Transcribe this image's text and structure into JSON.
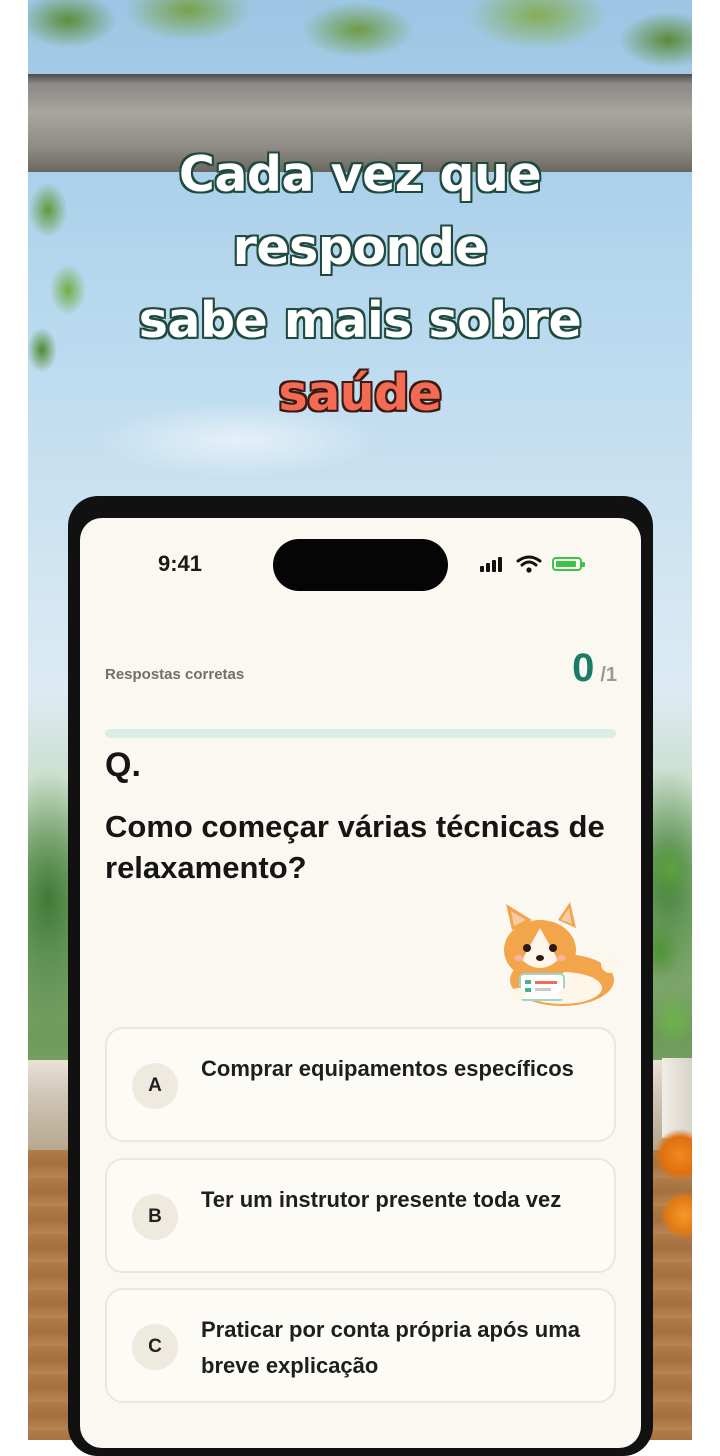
{
  "headline": {
    "line1": "Cada vez que",
    "line2": "responde",
    "line3": "sabe mais sobre",
    "highlight": "saúde"
  },
  "status_bar": {
    "time": "9:41",
    "icons": [
      "signal-icon",
      "wifi-icon",
      "battery-charging-icon"
    ]
  },
  "quiz": {
    "score_label": "Respostas corretas",
    "score_value": "0",
    "score_total": "/1",
    "progress_fraction": 0,
    "question_marker": "Q.",
    "question": "Como começar várias técnicas de relaxamento?",
    "mascot": "corgi-mascot-icon",
    "options": [
      {
        "letter": "A",
        "text": "Comprar equipamentos específicos"
      },
      {
        "letter": "B",
        "text": "Ter um instrutor presente toda vez"
      },
      {
        "letter": "C",
        "text": "Praticar por conta própria após uma breve explicação"
      }
    ]
  },
  "colors": {
    "accent": "#1c7a68",
    "highlight": "#f26b52",
    "progress_track": "#dbeee5",
    "screen_background": "#fbf8f1"
  }
}
